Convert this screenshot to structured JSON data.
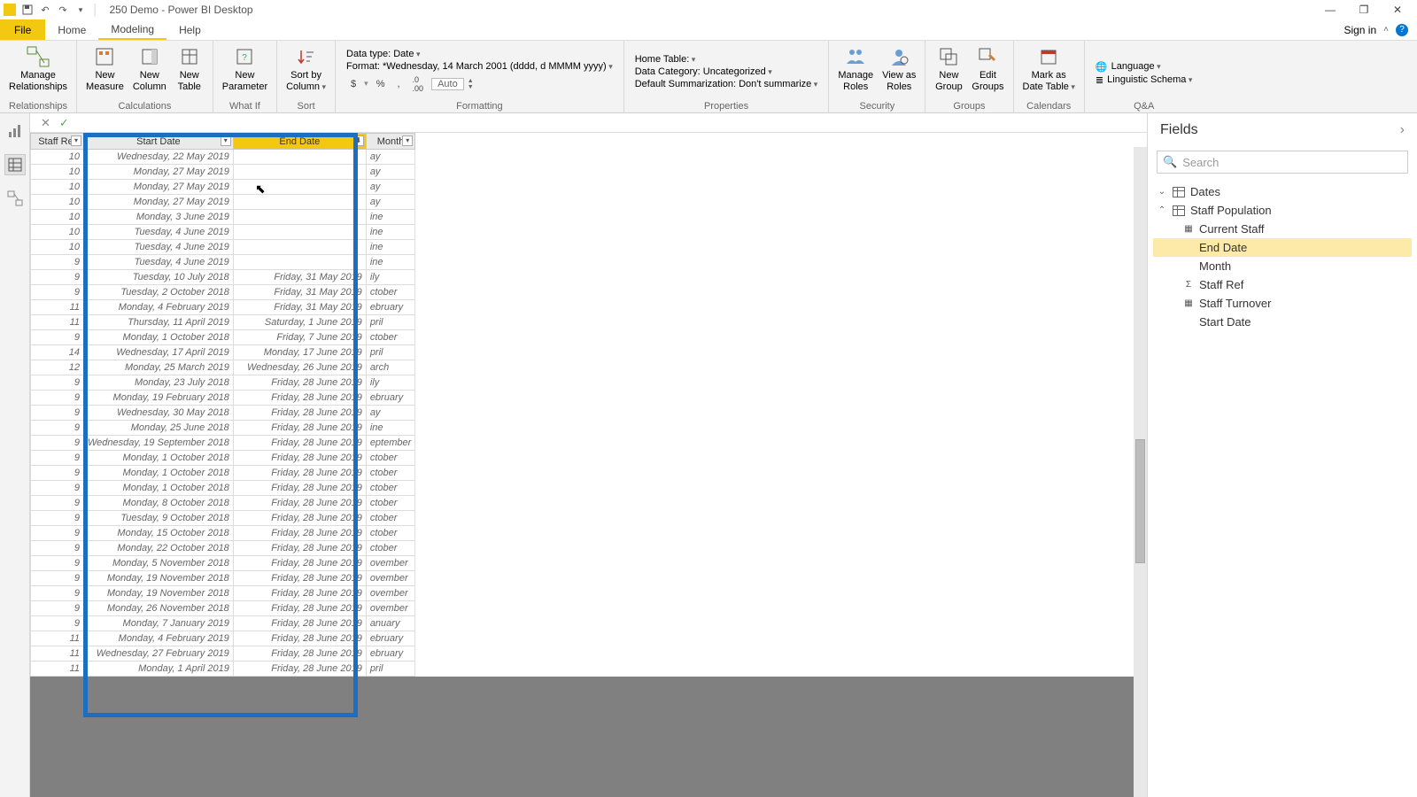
{
  "titlebar": {
    "title": "250 Demo - Power BI Desktop"
  },
  "ribbon_tabs": {
    "file": "File",
    "home": "Home",
    "modeling": "Modeling",
    "help": "Help",
    "signin": "Sign in"
  },
  "ribbon": {
    "relationships": {
      "manage": "Manage\nRelationships",
      "group": "Relationships"
    },
    "calculations": {
      "new_measure": "New\nMeasure",
      "new_column": "New\nColumn",
      "new_table": "New\nTable",
      "group": "Calculations"
    },
    "whatif": {
      "new_parameter": "New\nParameter",
      "group": "What If"
    },
    "sort": {
      "sort_by": "Sort by\nColumn",
      "group": "Sort"
    },
    "formatting": {
      "datatype": "Data type: Date",
      "format": "Format: *Wednesday, 14 March 2001 (dddd, d MMMM yyyy)",
      "currency": "$",
      "percent": "%",
      "comma": ",",
      "decimals": ".00",
      "auto": "Auto",
      "group": "Formatting"
    },
    "properties": {
      "home_table": "Home Table:",
      "data_category": "Data Category: Uncategorized",
      "default_sum": "Default Summarization: Don't summarize",
      "group": "Properties"
    },
    "security": {
      "manage_roles": "Manage\nRoles",
      "view_as": "View as\nRoles",
      "group": "Security"
    },
    "groups": {
      "new_group": "New\nGroup",
      "edit_groups": "Edit\nGroups",
      "group": "Groups"
    },
    "calendars": {
      "mark_as": "Mark as\nDate Table",
      "group": "Calendars"
    },
    "qa": {
      "language": "Language",
      "schema": "Linguistic Schema",
      "group": "Q&A"
    }
  },
  "columns": {
    "staff_ref": "Staff Ref",
    "start_date": "Start Date",
    "end_date": "End Date",
    "month": "Month"
  },
  "rows": [
    {
      "ref": "10",
      "start": "Wednesday, 22 May 2019",
      "end": "",
      "month": "ay"
    },
    {
      "ref": "10",
      "start": "Monday, 27 May 2019",
      "end": "",
      "month": "ay"
    },
    {
      "ref": "10",
      "start": "Monday, 27 May 2019",
      "end": "",
      "month": "ay"
    },
    {
      "ref": "10",
      "start": "Monday, 27 May 2019",
      "end": "",
      "month": "ay"
    },
    {
      "ref": "10",
      "start": "Monday, 3 June 2019",
      "end": "",
      "month": "ine"
    },
    {
      "ref": "10",
      "start": "Tuesday, 4 June 2019",
      "end": "",
      "month": "ine"
    },
    {
      "ref": "10",
      "start": "Tuesday, 4 June 2019",
      "end": "",
      "month": "ine"
    },
    {
      "ref": "9",
      "start": "Tuesday, 4 June 2019",
      "end": "",
      "month": "ine"
    },
    {
      "ref": "9",
      "start": "Tuesday, 10 July 2018",
      "end": "Friday, 31 May 2019",
      "month": "ily"
    },
    {
      "ref": "9",
      "start": "Tuesday, 2 October 2018",
      "end": "Friday, 31 May 2019",
      "month": "ctober"
    },
    {
      "ref": "11",
      "start": "Monday, 4 February 2019",
      "end": "Friday, 31 May 2019",
      "month": "ebruary"
    },
    {
      "ref": "11",
      "start": "Thursday, 11 April 2019",
      "end": "Saturday, 1 June 2019",
      "month": "pril"
    },
    {
      "ref": "9",
      "start": "Monday, 1 October 2018",
      "end": "Friday, 7 June 2019",
      "month": "ctober"
    },
    {
      "ref": "14",
      "start": "Wednesday, 17 April 2019",
      "end": "Monday, 17 June 2019",
      "month": "pril"
    },
    {
      "ref": "12",
      "start": "Monday, 25 March 2019",
      "end": "Wednesday, 26 June 2019",
      "month": "arch"
    },
    {
      "ref": "9",
      "start": "Monday, 23 July 2018",
      "end": "Friday, 28 June 2019",
      "month": "ily"
    },
    {
      "ref": "9",
      "start": "Monday, 19 February 2018",
      "end": "Friday, 28 June 2019",
      "month": "ebruary"
    },
    {
      "ref": "9",
      "start": "Wednesday, 30 May 2018",
      "end": "Friday, 28 June 2019",
      "month": "ay"
    },
    {
      "ref": "9",
      "start": "Monday, 25 June 2018",
      "end": "Friday, 28 June 2019",
      "month": "ine"
    },
    {
      "ref": "9",
      "start": "Wednesday, 19 September 2018",
      "end": "Friday, 28 June 2019",
      "month": "eptember"
    },
    {
      "ref": "9",
      "start": "Monday, 1 October 2018",
      "end": "Friday, 28 June 2019",
      "month": "ctober"
    },
    {
      "ref": "9",
      "start": "Monday, 1 October 2018",
      "end": "Friday, 28 June 2019",
      "month": "ctober"
    },
    {
      "ref": "9",
      "start": "Monday, 1 October 2018",
      "end": "Friday, 28 June 2019",
      "month": "ctober"
    },
    {
      "ref": "9",
      "start": "Monday, 8 October 2018",
      "end": "Friday, 28 June 2019",
      "month": "ctober"
    },
    {
      "ref": "9",
      "start": "Tuesday, 9 October 2018",
      "end": "Friday, 28 June 2019",
      "month": "ctober"
    },
    {
      "ref": "9",
      "start": "Monday, 15 October 2018",
      "end": "Friday, 28 June 2019",
      "month": "ctober"
    },
    {
      "ref": "9",
      "start": "Monday, 22 October 2018",
      "end": "Friday, 28 June 2019",
      "month": "ctober"
    },
    {
      "ref": "9",
      "start": "Monday, 5 November 2018",
      "end": "Friday, 28 June 2019",
      "month": "ovember"
    },
    {
      "ref": "9",
      "start": "Monday, 19 November 2018",
      "end": "Friday, 28 June 2019",
      "month": "ovember"
    },
    {
      "ref": "9",
      "start": "Monday, 19 November 2018",
      "end": "Friday, 28 June 2019",
      "month": "ovember"
    },
    {
      "ref": "9",
      "start": "Monday, 26 November 2018",
      "end": "Friday, 28 June 2019",
      "month": "ovember"
    },
    {
      "ref": "9",
      "start": "Monday, 7 January 2019",
      "end": "Friday, 28 June 2019",
      "month": "anuary"
    },
    {
      "ref": "11",
      "start": "Monday, 4 February 2019",
      "end": "Friday, 28 June 2019",
      "month": "ebruary"
    },
    {
      "ref": "11",
      "start": "Wednesday, 27 February 2019",
      "end": "Friday, 28 June 2019",
      "month": "ebruary"
    },
    {
      "ref": "11",
      "start": "Monday, 1 April 2019",
      "end": "Friday, 28 June 2019",
      "month": "pril"
    }
  ],
  "fields": {
    "title": "Fields",
    "search_placeholder": "Search",
    "tables": {
      "dates": "Dates",
      "staff_pop": "Staff Population",
      "items": {
        "current_staff": "Current Staff",
        "end_date": "End Date",
        "month": "Month",
        "staff_ref": "Staff Ref",
        "staff_turnover": "Staff Turnover",
        "start_date": "Start Date"
      }
    }
  }
}
